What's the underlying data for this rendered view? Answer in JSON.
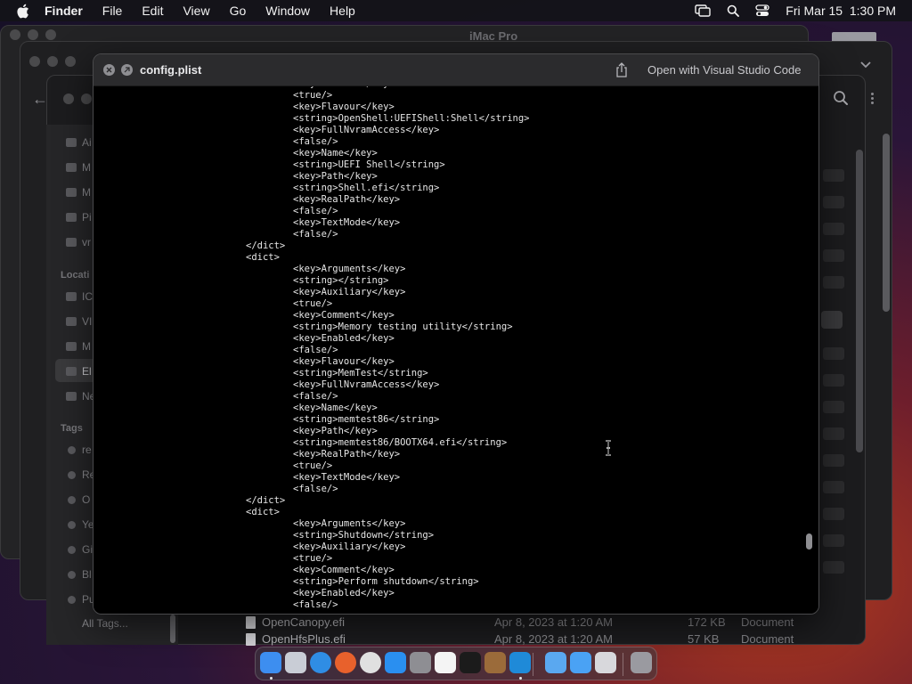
{
  "menubar": {
    "app": "Finder",
    "menus": [
      "File",
      "Edit",
      "View",
      "Go",
      "Window",
      "Help"
    ],
    "datetime": "Fri Mar 15  1:30 PM"
  },
  "background_window": {
    "title": "iMac Pro"
  },
  "finder_sidebar": {
    "items_top": [
      "Ai",
      "M",
      "M",
      "Pi",
      "vr"
    ],
    "locations_header": "Locati",
    "locations": [
      "IC",
      "VI",
      "M",
      "El",
      "Ne"
    ],
    "tags_header": "Tags",
    "tags": [
      "re",
      "Re",
      "O",
      "Ye",
      "Gi",
      "Bl",
      "Pu"
    ],
    "all_tags": "All Tags..."
  },
  "file_list": [
    {
      "name": "OpenCanopy.efi",
      "date": "Apr 8, 2023 at 1:20 AM",
      "size": "172 KB",
      "kind": "Document"
    },
    {
      "name": "OpenHfsPlus.efi",
      "date": "Apr 8, 2023 at 1:20 AM",
      "size": "57 KB",
      "kind": "Document"
    }
  ],
  "quicklook": {
    "title": "config.plist",
    "open_with": "Open with Visual Studio Code",
    "lines": [
      "\t\t\t\t<key>Enabled</key>",
      "\t\t\t\t<true/>",
      "\t\t\t\t<key>Flavour</key>",
      "\t\t\t\t<string>OpenShell:UEFIShell:Shell</string>",
      "\t\t\t\t<key>FullNvramAccess</key>",
      "\t\t\t\t<false/>",
      "\t\t\t\t<key>Name</key>",
      "\t\t\t\t<string>UEFI Shell</string>",
      "\t\t\t\t<key>Path</key>",
      "\t\t\t\t<string>Shell.efi</string>",
      "\t\t\t\t<key>RealPath</key>",
      "\t\t\t\t<false/>",
      "\t\t\t\t<key>TextMode</key>",
      "\t\t\t\t<false/>",
      "\t\t\t</dict>",
      "\t\t\t<dict>",
      "\t\t\t\t<key>Arguments</key>",
      "\t\t\t\t<string></string>",
      "\t\t\t\t<key>Auxiliary</key>",
      "\t\t\t\t<true/>",
      "\t\t\t\t<key>Comment</key>",
      "\t\t\t\t<string>Memory testing utility</string>",
      "\t\t\t\t<key>Enabled</key>",
      "\t\t\t\t<false/>",
      "\t\t\t\t<key>Flavour</key>",
      "\t\t\t\t<string>MemTest</string>",
      "\t\t\t\t<key>FullNvramAccess</key>",
      "\t\t\t\t<false/>",
      "\t\t\t\t<key>Name</key>",
      "\t\t\t\t<string>memtest86</string>",
      "\t\t\t\t<key>Path</key>",
      "\t\t\t\t<string>memtest86/BOOTX64.efi</string>",
      "\t\t\t\t<key>RealPath</key>",
      "\t\t\t\t<true/>",
      "\t\t\t\t<key>TextMode</key>",
      "\t\t\t\t<false/>",
      "\t\t\t</dict>",
      "\t\t\t<dict>",
      "\t\t\t\t<key>Arguments</key>",
      "\t\t\t\t<string>Shutdown</string>",
      "\t\t\t\t<key>Auxiliary</key>",
      "\t\t\t\t<true/>",
      "\t\t\t\t<key>Comment</key>",
      "\t\t\t\t<string>Perform shutdown</string>",
      "\t\t\t\t<key>Enabled</key>",
      "\t\t\t\t<false/>"
    ]
  },
  "dock": {
    "apps": [
      {
        "name": "finder-icon",
        "color": "#3d8ef0"
      },
      {
        "name": "launchpad-icon",
        "color": "#c9cdd6"
      },
      {
        "name": "safari-icon",
        "color": "#2f8de4"
      },
      {
        "name": "firefox-icon",
        "color": "#e8612c"
      },
      {
        "name": "chrome-icon",
        "color": "#e0e0e0"
      },
      {
        "name": "app-store-icon",
        "color": "#2a8ff0"
      },
      {
        "name": "system-settings-icon",
        "color": "#8e8e93"
      },
      {
        "name": "textedit-icon",
        "color": "#f4f4f4"
      },
      {
        "name": "terminal-icon",
        "color": "#1b1b1b"
      },
      {
        "name": "brush-app-icon",
        "color": "#9b6b3a"
      },
      {
        "name": "vscode-icon",
        "color": "#1f8ad8"
      },
      {
        "name": "icloud-icon",
        "color": "#5aa8f0"
      },
      {
        "name": "preview-icon",
        "color": "#4aa2f4"
      },
      {
        "name": "printer-icon",
        "color": "#d8d8dc"
      },
      {
        "name": "trash-icon",
        "color": "#9a9aa0"
      }
    ]
  }
}
